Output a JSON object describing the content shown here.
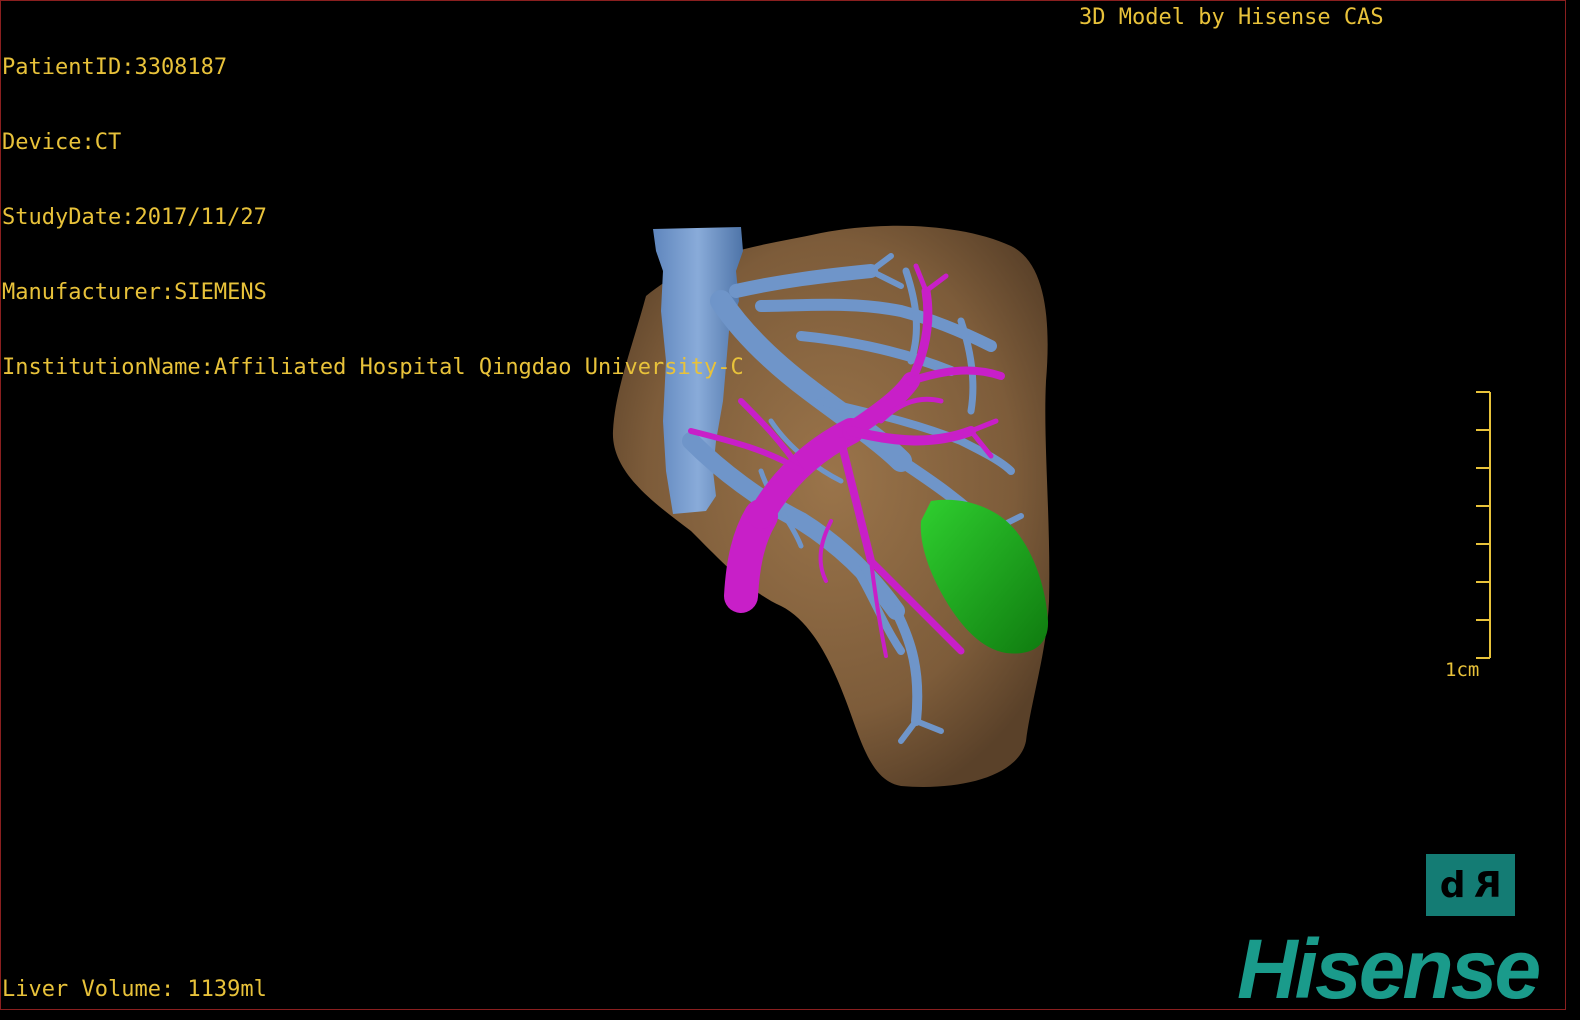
{
  "study_info": {
    "patient_id": "PatientID:3308187",
    "device": "Device:CT",
    "study_date": "StudyDate:2017/11/27",
    "manufacturer": "Manufacturer:SIEMENS",
    "institution": "InstitutionName:Affiliated Hospital Qingdao University-C"
  },
  "model_credit": "3D Model by Hisense CAS",
  "liver_volume": "Liver Volume: 1139ml",
  "scale": {
    "label": "1cm"
  },
  "orientation": {
    "left": "d",
    "right": "R"
  },
  "brand": "Hisense",
  "colors": {
    "overlay_text": "#e8c23a",
    "liver": "#8d6a43",
    "hepatic_vein": "#6f95c9",
    "portal_vein": "#c81fc8",
    "tumor": "#1fa51f",
    "brand": "#1a9b8b",
    "orient_widget_bg": "#147c74",
    "border": "#8a1f1f"
  }
}
